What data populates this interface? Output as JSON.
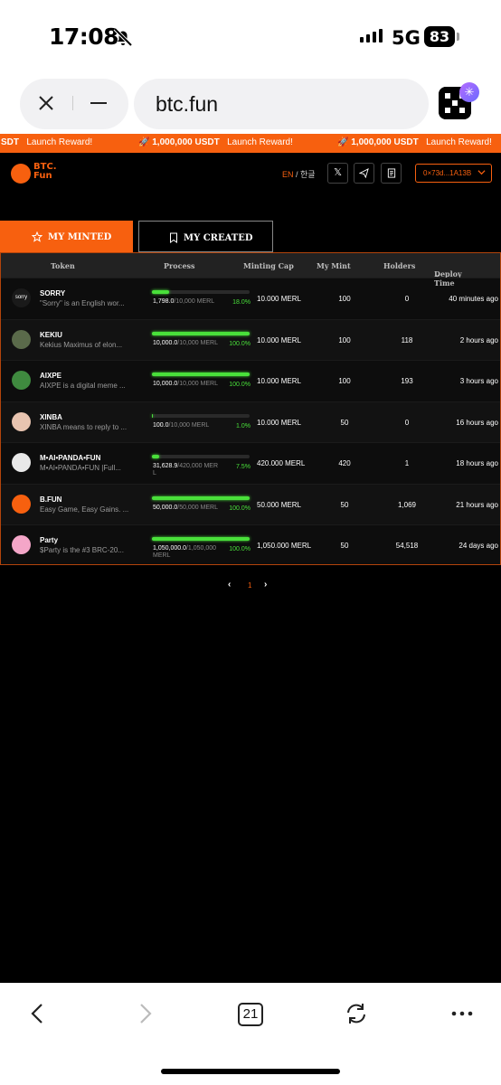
{
  "status": {
    "time": "17:08",
    "network": "5G",
    "battery": "83"
  },
  "browser": {
    "url": "btc.fun",
    "tab_count": "21"
  },
  "ticker": [
    {
      "pre": "SDT",
      "reward": "Launch Reward!"
    },
    {
      "amount": "1,000,000 USDT",
      "reward": "Launch Reward!"
    },
    {
      "amount": "1,000,000 USDT",
      "reward": "Launch Reward!"
    }
  ],
  "header": {
    "logo_line1": "BTC.",
    "logo_line2": "Fun",
    "lang_en": "EN",
    "lang_sep": " / ",
    "lang_kr": "한글",
    "wallet": "0×73d...1A13B"
  },
  "tabs": {
    "minted": "MY MINTED",
    "created": "MY CREATED"
  },
  "columns": {
    "token": "Token",
    "process": "Process",
    "cap": "Minting Cap",
    "mint": "My Mint",
    "holders": "Holders",
    "deploy": "Deploy Time"
  },
  "rows": [
    {
      "name": "SORRY",
      "desc": "\"Sorry\" is an English wor...",
      "minted": "1,798.0",
      "cap_total": "/10,000 MERL",
      "pct": "18.0%",
      "fill": 0.18,
      "cap": "10.000 MERL",
      "mine": "100",
      "holders": "0",
      "deploy": "40 minutes ago",
      "avatar_color": "#1a1a1a",
      "avatar_text": "sorry"
    },
    {
      "name": "KEKIU",
      "desc": "Kekius Maximus of elon...",
      "minted": "10,000.0",
      "cap_total": "/10,000 MERL",
      "pct": "100.0%",
      "fill": 1.0,
      "cap": "10.000 MERL",
      "mine": "100",
      "holders": "118",
      "deploy": "2 hours ago",
      "avatar_color": "#5a6a4a",
      "avatar_text": ""
    },
    {
      "name": "AIXPE",
      "desc": "AIXPE is a digital meme ...",
      "minted": "10,000.0",
      "cap_total": "/10,000 MERL",
      "pct": "100.0%",
      "fill": 1.0,
      "cap": "10.000 MERL",
      "mine": "100",
      "holders": "193",
      "deploy": "3 hours ago",
      "avatar_color": "#3f8a3f",
      "avatar_text": ""
    },
    {
      "name": "XINBA",
      "desc": "XINBA means to reply to ...",
      "minted": "100.0",
      "cap_total": "/10,000 MERL",
      "pct": "1.0%",
      "fill": 0.01,
      "cap": "10.000 MERL",
      "mine": "50",
      "holders": "0",
      "deploy": "16 hours ago",
      "avatar_color": "#e8c4b0",
      "avatar_text": ""
    },
    {
      "name": "M•AI•PANDA•FUN",
      "desc": "M•AI•PANDA•FUN |Full...",
      "minted": "31,628.9",
      "cap_total": "/420,000 MERL",
      "pct": "7.5%",
      "fill": 0.075,
      "cap": "420.000 MERL",
      "mine": "420",
      "holders": "1",
      "deploy": "18 hours ago",
      "avatar_color": "#e9e9e9",
      "avatar_text": ""
    },
    {
      "name": "B.FUN",
      "desc": "Easy Game, Easy Gains. ...",
      "minted": "50,000.0",
      "cap_total": "/50,000 MERL",
      "pct": "100.0%",
      "fill": 1.0,
      "cap": "50.000 MERL",
      "mine": "50",
      "holders": "1,069",
      "deploy": "21 hours ago",
      "avatar_color": "#f7600f",
      "avatar_text": ""
    },
    {
      "name": "Party",
      "desc": "$Party is the #3 BRC-20...",
      "minted": "1,050,000.0",
      "cap_total": "/1,050,000 MERL",
      "pct": "100.0%",
      "fill": 1.0,
      "cap": "1,050.000 MERL",
      "mine": "50",
      "holders": "54,518",
      "deploy": "24 days ago",
      "avatar_color": "#f4a6c8",
      "avatar_text": ""
    }
  ],
  "pager": {
    "current": "1"
  }
}
